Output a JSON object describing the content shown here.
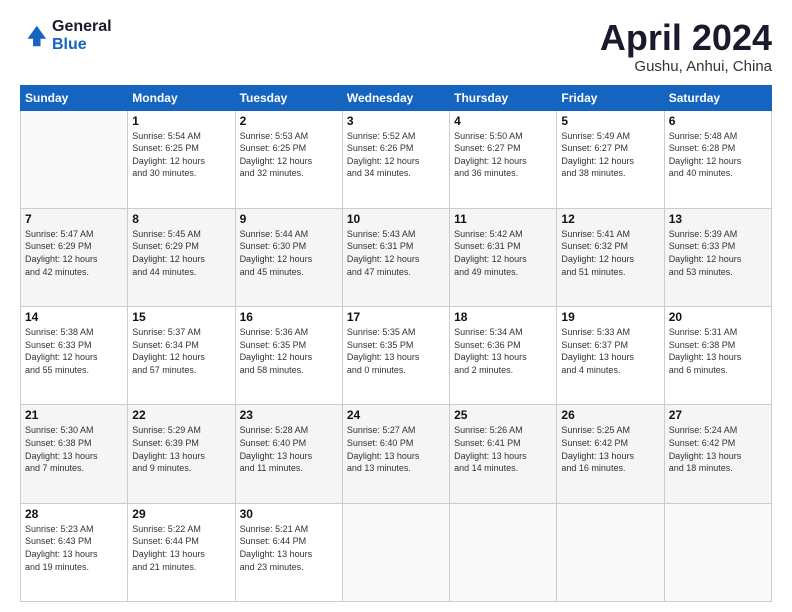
{
  "logo": {
    "line1": "General",
    "line2": "Blue"
  },
  "title": "April 2024",
  "subtitle": "Gushu, Anhui, China",
  "days_header": [
    "Sunday",
    "Monday",
    "Tuesday",
    "Wednesday",
    "Thursday",
    "Friday",
    "Saturday"
  ],
  "weeks": [
    [
      {
        "day": "",
        "info": ""
      },
      {
        "day": "1",
        "info": "Sunrise: 5:54 AM\nSunset: 6:25 PM\nDaylight: 12 hours\nand 30 minutes."
      },
      {
        "day": "2",
        "info": "Sunrise: 5:53 AM\nSunset: 6:25 PM\nDaylight: 12 hours\nand 32 minutes."
      },
      {
        "day": "3",
        "info": "Sunrise: 5:52 AM\nSunset: 6:26 PM\nDaylight: 12 hours\nand 34 minutes."
      },
      {
        "day": "4",
        "info": "Sunrise: 5:50 AM\nSunset: 6:27 PM\nDaylight: 12 hours\nand 36 minutes."
      },
      {
        "day": "5",
        "info": "Sunrise: 5:49 AM\nSunset: 6:27 PM\nDaylight: 12 hours\nand 38 minutes."
      },
      {
        "day": "6",
        "info": "Sunrise: 5:48 AM\nSunset: 6:28 PM\nDaylight: 12 hours\nand 40 minutes."
      }
    ],
    [
      {
        "day": "7",
        "info": "Sunrise: 5:47 AM\nSunset: 6:29 PM\nDaylight: 12 hours\nand 42 minutes."
      },
      {
        "day": "8",
        "info": "Sunrise: 5:45 AM\nSunset: 6:29 PM\nDaylight: 12 hours\nand 44 minutes."
      },
      {
        "day": "9",
        "info": "Sunrise: 5:44 AM\nSunset: 6:30 PM\nDaylight: 12 hours\nand 45 minutes."
      },
      {
        "day": "10",
        "info": "Sunrise: 5:43 AM\nSunset: 6:31 PM\nDaylight: 12 hours\nand 47 minutes."
      },
      {
        "day": "11",
        "info": "Sunrise: 5:42 AM\nSunset: 6:31 PM\nDaylight: 12 hours\nand 49 minutes."
      },
      {
        "day": "12",
        "info": "Sunrise: 5:41 AM\nSunset: 6:32 PM\nDaylight: 12 hours\nand 51 minutes."
      },
      {
        "day": "13",
        "info": "Sunrise: 5:39 AM\nSunset: 6:33 PM\nDaylight: 12 hours\nand 53 minutes."
      }
    ],
    [
      {
        "day": "14",
        "info": "Sunrise: 5:38 AM\nSunset: 6:33 PM\nDaylight: 12 hours\nand 55 minutes."
      },
      {
        "day": "15",
        "info": "Sunrise: 5:37 AM\nSunset: 6:34 PM\nDaylight: 12 hours\nand 57 minutes."
      },
      {
        "day": "16",
        "info": "Sunrise: 5:36 AM\nSunset: 6:35 PM\nDaylight: 12 hours\nand 58 minutes."
      },
      {
        "day": "17",
        "info": "Sunrise: 5:35 AM\nSunset: 6:35 PM\nDaylight: 13 hours\nand 0 minutes."
      },
      {
        "day": "18",
        "info": "Sunrise: 5:34 AM\nSunset: 6:36 PM\nDaylight: 13 hours\nand 2 minutes."
      },
      {
        "day": "19",
        "info": "Sunrise: 5:33 AM\nSunset: 6:37 PM\nDaylight: 13 hours\nand 4 minutes."
      },
      {
        "day": "20",
        "info": "Sunrise: 5:31 AM\nSunset: 6:38 PM\nDaylight: 13 hours\nand 6 minutes."
      }
    ],
    [
      {
        "day": "21",
        "info": "Sunrise: 5:30 AM\nSunset: 6:38 PM\nDaylight: 13 hours\nand 7 minutes."
      },
      {
        "day": "22",
        "info": "Sunrise: 5:29 AM\nSunset: 6:39 PM\nDaylight: 13 hours\nand 9 minutes."
      },
      {
        "day": "23",
        "info": "Sunrise: 5:28 AM\nSunset: 6:40 PM\nDaylight: 13 hours\nand 11 minutes."
      },
      {
        "day": "24",
        "info": "Sunrise: 5:27 AM\nSunset: 6:40 PM\nDaylight: 13 hours\nand 13 minutes."
      },
      {
        "day": "25",
        "info": "Sunrise: 5:26 AM\nSunset: 6:41 PM\nDaylight: 13 hours\nand 14 minutes."
      },
      {
        "day": "26",
        "info": "Sunrise: 5:25 AM\nSunset: 6:42 PM\nDaylight: 13 hours\nand 16 minutes."
      },
      {
        "day": "27",
        "info": "Sunrise: 5:24 AM\nSunset: 6:42 PM\nDaylight: 13 hours\nand 18 minutes."
      }
    ],
    [
      {
        "day": "28",
        "info": "Sunrise: 5:23 AM\nSunset: 6:43 PM\nDaylight: 13 hours\nand 19 minutes."
      },
      {
        "day": "29",
        "info": "Sunrise: 5:22 AM\nSunset: 6:44 PM\nDaylight: 13 hours\nand 21 minutes."
      },
      {
        "day": "30",
        "info": "Sunrise: 5:21 AM\nSunset: 6:44 PM\nDaylight: 13 hours\nand 23 minutes."
      },
      {
        "day": "",
        "info": ""
      },
      {
        "day": "",
        "info": ""
      },
      {
        "day": "",
        "info": ""
      },
      {
        "day": "",
        "info": ""
      }
    ]
  ]
}
